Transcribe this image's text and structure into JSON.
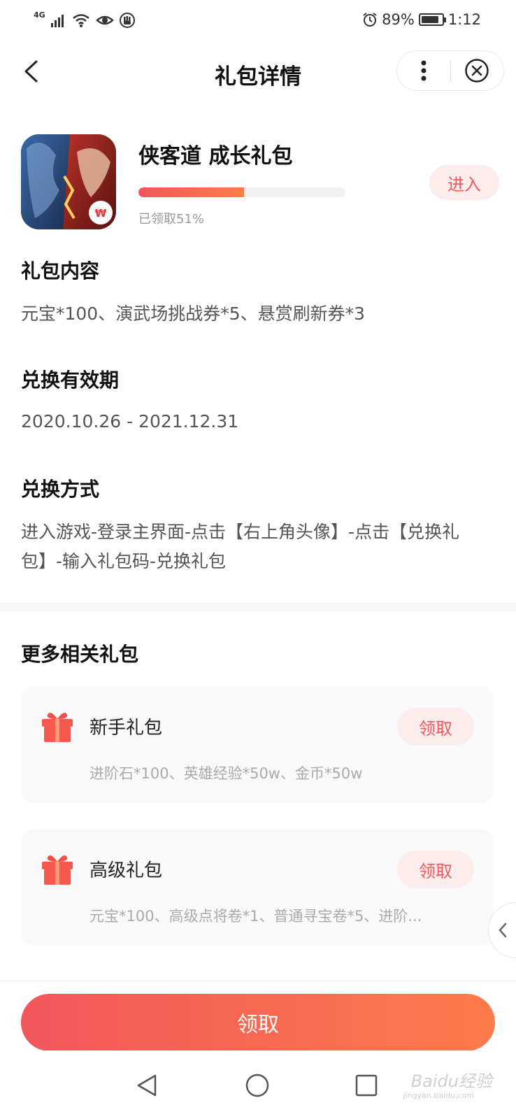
{
  "status_bar": {
    "network": "4G",
    "battery_percent": "89%",
    "battery_level": 0.89,
    "time": "1:12",
    "icons": [
      "signal-icon",
      "wifi-icon",
      "eye-icon",
      "hand-icon",
      "alarm-icon",
      "battery-icon"
    ]
  },
  "header": {
    "title": "礼包详情"
  },
  "game": {
    "title": "侠客道 成长礼包",
    "progress": 0.51,
    "claimed_text": "已领取51%",
    "enter_label": "进入"
  },
  "sections": {
    "content": {
      "title": "礼包内容",
      "text": "元宝*100、演武场挑战券*5、悬赏刷新券*3"
    },
    "validity": {
      "title": "兑换有效期",
      "text": "2020.10.26 - 2021.12.31"
    },
    "method": {
      "title": "兑换方式",
      "text": "进入游戏-登录主界面-点击【右上角头像】-点击【兑换礼包】-输入礼包码-兑换礼包"
    },
    "more": {
      "title": "更多相关礼包"
    }
  },
  "related_gifts": [
    {
      "name": "新手礼包",
      "button": "领取",
      "content": "进阶石*100、英雄经验*50w、金币*50w"
    },
    {
      "name": "高级礼包",
      "button": "领取",
      "content": "元宝*100、高级点将卷*1、普通寻宝卷*5、进阶..."
    }
  ],
  "bottom": {
    "claim_label": "领取"
  },
  "watermark": {
    "text": "Baidu经验",
    "sub": "jingyan.baidu.com"
  },
  "colors": {
    "accent": "#f05a5a",
    "accent_light": "#fdecec",
    "gradient_start": "#f1565a",
    "gradient_end": "#ff7b4a"
  }
}
